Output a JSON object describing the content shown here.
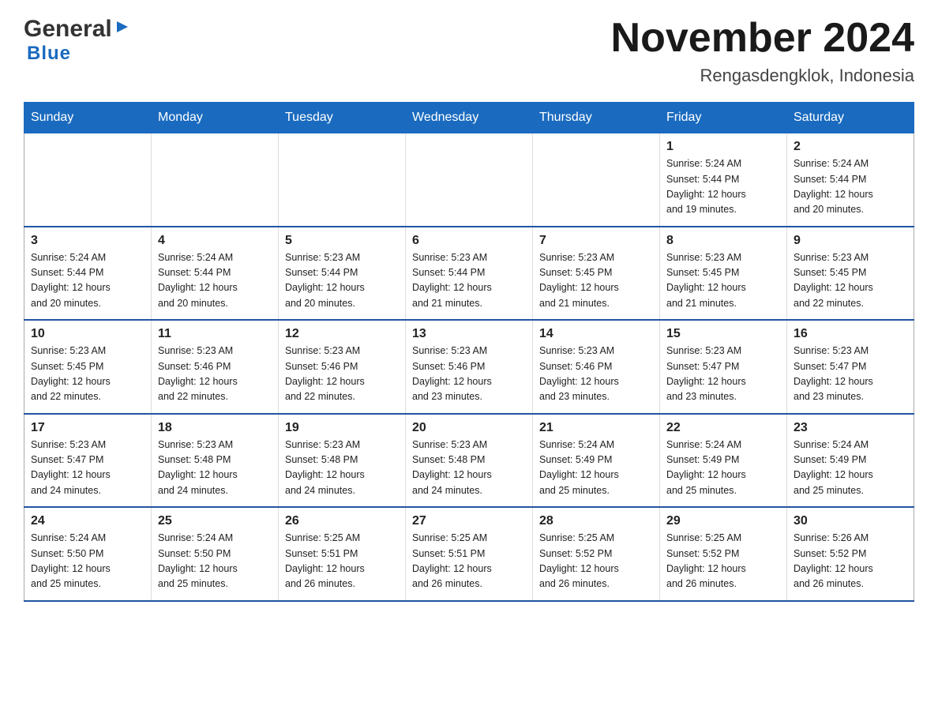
{
  "logo": {
    "general": "General",
    "blue": "Blue",
    "arrow": "▶"
  },
  "title": "November 2024",
  "location": "Rengasdengklok, Indonesia",
  "days_of_week": [
    "Sunday",
    "Monday",
    "Tuesday",
    "Wednesday",
    "Thursday",
    "Friday",
    "Saturday"
  ],
  "weeks": [
    [
      {
        "day": "",
        "info": ""
      },
      {
        "day": "",
        "info": ""
      },
      {
        "day": "",
        "info": ""
      },
      {
        "day": "",
        "info": ""
      },
      {
        "day": "",
        "info": ""
      },
      {
        "day": "1",
        "info": "Sunrise: 5:24 AM\nSunset: 5:44 PM\nDaylight: 12 hours\nand 19 minutes."
      },
      {
        "day": "2",
        "info": "Sunrise: 5:24 AM\nSunset: 5:44 PM\nDaylight: 12 hours\nand 20 minutes."
      }
    ],
    [
      {
        "day": "3",
        "info": "Sunrise: 5:24 AM\nSunset: 5:44 PM\nDaylight: 12 hours\nand 20 minutes."
      },
      {
        "day": "4",
        "info": "Sunrise: 5:24 AM\nSunset: 5:44 PM\nDaylight: 12 hours\nand 20 minutes."
      },
      {
        "day": "5",
        "info": "Sunrise: 5:23 AM\nSunset: 5:44 PM\nDaylight: 12 hours\nand 20 minutes."
      },
      {
        "day": "6",
        "info": "Sunrise: 5:23 AM\nSunset: 5:44 PM\nDaylight: 12 hours\nand 21 minutes."
      },
      {
        "day": "7",
        "info": "Sunrise: 5:23 AM\nSunset: 5:45 PM\nDaylight: 12 hours\nand 21 minutes."
      },
      {
        "day": "8",
        "info": "Sunrise: 5:23 AM\nSunset: 5:45 PM\nDaylight: 12 hours\nand 21 minutes."
      },
      {
        "day": "9",
        "info": "Sunrise: 5:23 AM\nSunset: 5:45 PM\nDaylight: 12 hours\nand 22 minutes."
      }
    ],
    [
      {
        "day": "10",
        "info": "Sunrise: 5:23 AM\nSunset: 5:45 PM\nDaylight: 12 hours\nand 22 minutes."
      },
      {
        "day": "11",
        "info": "Sunrise: 5:23 AM\nSunset: 5:46 PM\nDaylight: 12 hours\nand 22 minutes."
      },
      {
        "day": "12",
        "info": "Sunrise: 5:23 AM\nSunset: 5:46 PM\nDaylight: 12 hours\nand 22 minutes."
      },
      {
        "day": "13",
        "info": "Sunrise: 5:23 AM\nSunset: 5:46 PM\nDaylight: 12 hours\nand 23 minutes."
      },
      {
        "day": "14",
        "info": "Sunrise: 5:23 AM\nSunset: 5:46 PM\nDaylight: 12 hours\nand 23 minutes."
      },
      {
        "day": "15",
        "info": "Sunrise: 5:23 AM\nSunset: 5:47 PM\nDaylight: 12 hours\nand 23 minutes."
      },
      {
        "day": "16",
        "info": "Sunrise: 5:23 AM\nSunset: 5:47 PM\nDaylight: 12 hours\nand 23 minutes."
      }
    ],
    [
      {
        "day": "17",
        "info": "Sunrise: 5:23 AM\nSunset: 5:47 PM\nDaylight: 12 hours\nand 24 minutes."
      },
      {
        "day": "18",
        "info": "Sunrise: 5:23 AM\nSunset: 5:48 PM\nDaylight: 12 hours\nand 24 minutes."
      },
      {
        "day": "19",
        "info": "Sunrise: 5:23 AM\nSunset: 5:48 PM\nDaylight: 12 hours\nand 24 minutes."
      },
      {
        "day": "20",
        "info": "Sunrise: 5:23 AM\nSunset: 5:48 PM\nDaylight: 12 hours\nand 24 minutes."
      },
      {
        "day": "21",
        "info": "Sunrise: 5:24 AM\nSunset: 5:49 PM\nDaylight: 12 hours\nand 25 minutes."
      },
      {
        "day": "22",
        "info": "Sunrise: 5:24 AM\nSunset: 5:49 PM\nDaylight: 12 hours\nand 25 minutes."
      },
      {
        "day": "23",
        "info": "Sunrise: 5:24 AM\nSunset: 5:49 PM\nDaylight: 12 hours\nand 25 minutes."
      }
    ],
    [
      {
        "day": "24",
        "info": "Sunrise: 5:24 AM\nSunset: 5:50 PM\nDaylight: 12 hours\nand 25 minutes."
      },
      {
        "day": "25",
        "info": "Sunrise: 5:24 AM\nSunset: 5:50 PM\nDaylight: 12 hours\nand 25 minutes."
      },
      {
        "day": "26",
        "info": "Sunrise: 5:25 AM\nSunset: 5:51 PM\nDaylight: 12 hours\nand 26 minutes."
      },
      {
        "day": "27",
        "info": "Sunrise: 5:25 AM\nSunset: 5:51 PM\nDaylight: 12 hours\nand 26 minutes."
      },
      {
        "day": "28",
        "info": "Sunrise: 5:25 AM\nSunset: 5:52 PM\nDaylight: 12 hours\nand 26 minutes."
      },
      {
        "day": "29",
        "info": "Sunrise: 5:25 AM\nSunset: 5:52 PM\nDaylight: 12 hours\nand 26 minutes."
      },
      {
        "day": "30",
        "info": "Sunrise: 5:26 AM\nSunset: 5:52 PM\nDaylight: 12 hours\nand 26 minutes."
      }
    ]
  ]
}
